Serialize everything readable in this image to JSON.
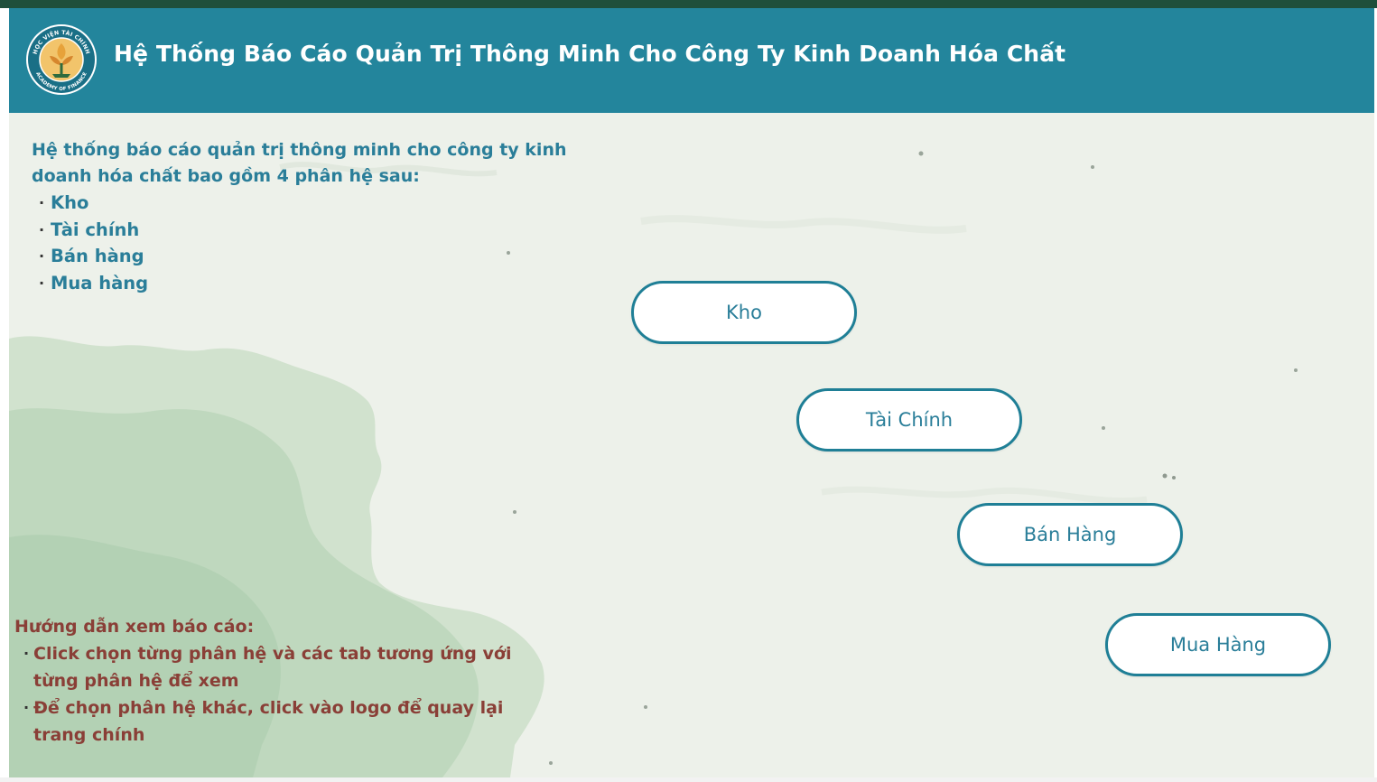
{
  "header": {
    "logo_text_top": "HỌC VIỆN TÀI CHÍNH",
    "logo_text_bottom": "ACADEMY OF FINANCE",
    "title": "Hệ Thống Báo Cáo Quản Trị Thông Minh Cho Công Ty Kinh Doanh Hóa Chất"
  },
  "intro": {
    "heading": "Hệ thống báo cáo quản trị thông minh cho công ty kinh doanh hóa chất bao gồm 4 phân hệ sau:",
    "items": [
      "Kho",
      "Tài chính",
      "Bán hàng",
      "Mua hàng"
    ]
  },
  "guide": {
    "heading": "Hướng dẫn xem báo cáo:",
    "items": [
      "Click chọn từng phân hệ và các tab tương ứng với từng phân hệ để xem",
      "Để chọn phân hệ khác, click vào logo để quay lại trang chính"
    ]
  },
  "buttons": {
    "kho": "Kho",
    "tai_chinh": "Tài Chính",
    "ban_hang": "Bán Hàng",
    "mua_hang": "Mua Hàng"
  },
  "colors": {
    "header_bg": "#23859c",
    "accent": "#2a7e99",
    "guide_text": "#8a3f37",
    "top_strip": "#1f4f3b"
  }
}
